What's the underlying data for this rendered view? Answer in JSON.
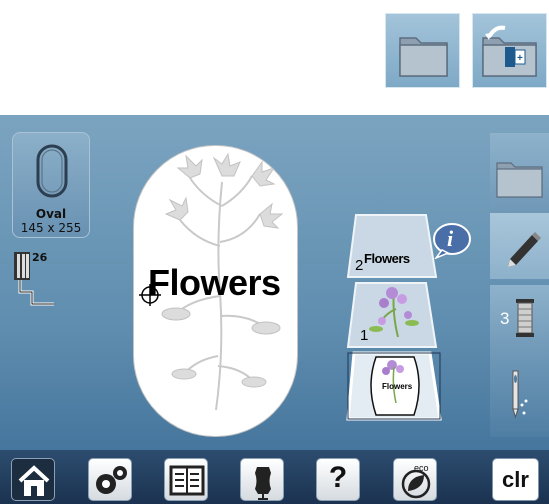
{
  "hoop": {
    "name": "Oval",
    "size": "145 x 255"
  },
  "presser_foot": {
    "number": "26"
  },
  "design": {
    "text": "Flowers"
  },
  "layers": [
    {
      "number": "2",
      "label": "Flowers",
      "info_icon": "i"
    },
    {
      "number": "1"
    },
    {
      "preview_text": "Flowers"
    }
  ],
  "side_tabs": {
    "thread_count": "3"
  },
  "bottom_bar": {
    "clear_label": "clr",
    "eco_label": "eco",
    "help_label": "?"
  },
  "colors": {
    "screen_top": "#7ba4c0",
    "screen_bottom": "#3b6b95",
    "bar": "#1b3250"
  }
}
